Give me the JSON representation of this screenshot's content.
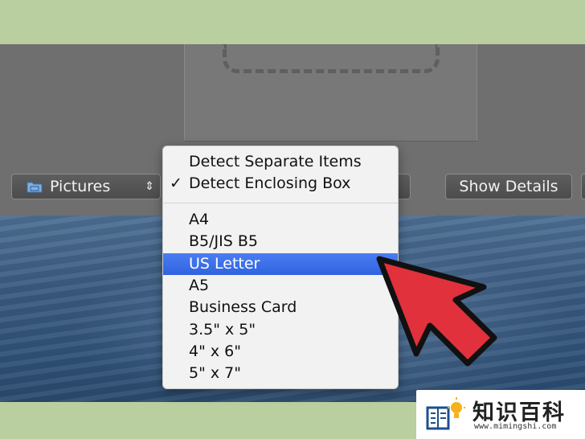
{
  "toolbar": {
    "folder_label": "Pictures",
    "stepper_glyph": "⇕",
    "show_details_label": "Show Details"
  },
  "menu": {
    "group1": [
      {
        "label": "Detect Separate Items",
        "checked": false
      },
      {
        "label": "Detect Enclosing Box",
        "checked": true
      }
    ],
    "check_glyph": "✓",
    "group2": [
      {
        "label": "A4",
        "selected": false
      },
      {
        "label": "B5/JIS B5",
        "selected": false
      },
      {
        "label": "US Letter",
        "selected": true
      },
      {
        "label": "A5",
        "selected": false
      },
      {
        "label": "Business Card",
        "selected": false
      },
      {
        "label": "3.5\" x 5\"",
        "selected": false
      },
      {
        "label": "4\" x 6\"",
        "selected": false
      },
      {
        "label": "5\" x 7\"",
        "selected": false
      }
    ]
  },
  "watermark": {
    "title": "知识百科",
    "url": "www.mimingshi.com"
  },
  "colors": {
    "highlight": "#2f62df",
    "annotation_arrow": "#e0313c"
  },
  "icons": [
    "folder-icon",
    "stepper-icon",
    "checkmark-icon",
    "lightbulb-book-icon",
    "pointer-arrow-annotation"
  ]
}
